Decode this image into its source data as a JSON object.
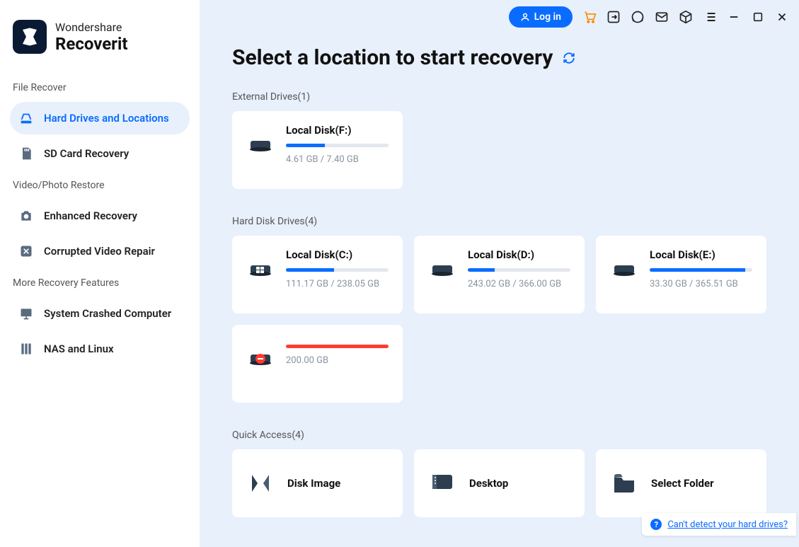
{
  "brand": {
    "line1": "Wondershare",
    "line2": "Recoverit"
  },
  "sidebar": {
    "sections": [
      {
        "label": "File Recover",
        "items": [
          {
            "name": "hard-drives",
            "label": "Hard Drives and Locations",
            "icon": "drive-icon",
            "active": true
          },
          {
            "name": "sd-card",
            "label": "SD Card Recovery",
            "icon": "sd-icon",
            "active": false
          }
        ]
      },
      {
        "label": "Video/Photo Restore",
        "items": [
          {
            "name": "enhanced",
            "label": "Enhanced Recovery",
            "icon": "camera-icon",
            "active": false
          },
          {
            "name": "corrupted",
            "label": "Corrupted Video Repair",
            "icon": "repair-icon",
            "active": false
          }
        ]
      },
      {
        "label": "More Recovery Features",
        "items": [
          {
            "name": "crashed",
            "label": "System Crashed Computer",
            "icon": "monitor-icon",
            "active": false
          },
          {
            "name": "nas",
            "label": "NAS and Linux",
            "icon": "server-icon",
            "active": false
          }
        ]
      }
    ]
  },
  "topbar": {
    "login": "Log in"
  },
  "title": "Select a location to start recovery",
  "groups": [
    {
      "label": "External Drives",
      "count": 1,
      "drives": [
        {
          "name": "Local Disk(F:)",
          "used": "4.61 GB",
          "total": "7.40 GB",
          "pct": 38,
          "icon": "ext",
          "error": false
        }
      ]
    },
    {
      "label": "Hard Disk Drives",
      "count": 4,
      "drives": [
        {
          "name": "Local Disk(C:)",
          "used": "111.17 GB",
          "total": "238.05 GB",
          "pct": 47,
          "icon": "win",
          "error": false
        },
        {
          "name": "Local Disk(D:)",
          "used": "243.02 GB",
          "total": "366.00 GB",
          "pct": 26,
          "icon": "hdd",
          "error": false
        },
        {
          "name": "Local Disk(E:)",
          "used": "33.30 GB",
          "total": "365.51 GB",
          "pct": 93,
          "icon": "hdd",
          "error": false
        },
        {
          "name": "",
          "used": "200.00 GB",
          "total": "",
          "pct": 100,
          "icon": "err",
          "error": true
        }
      ]
    }
  ],
  "quick": {
    "label": "Quick Access",
    "count": 4,
    "items": [
      {
        "label": "Disk Image",
        "icon": "diskimage"
      },
      {
        "label": "Desktop",
        "icon": "desktop"
      },
      {
        "label": "Select Folder",
        "icon": "folder"
      }
    ]
  },
  "help": {
    "text": "Can't detect your hard drives?"
  }
}
